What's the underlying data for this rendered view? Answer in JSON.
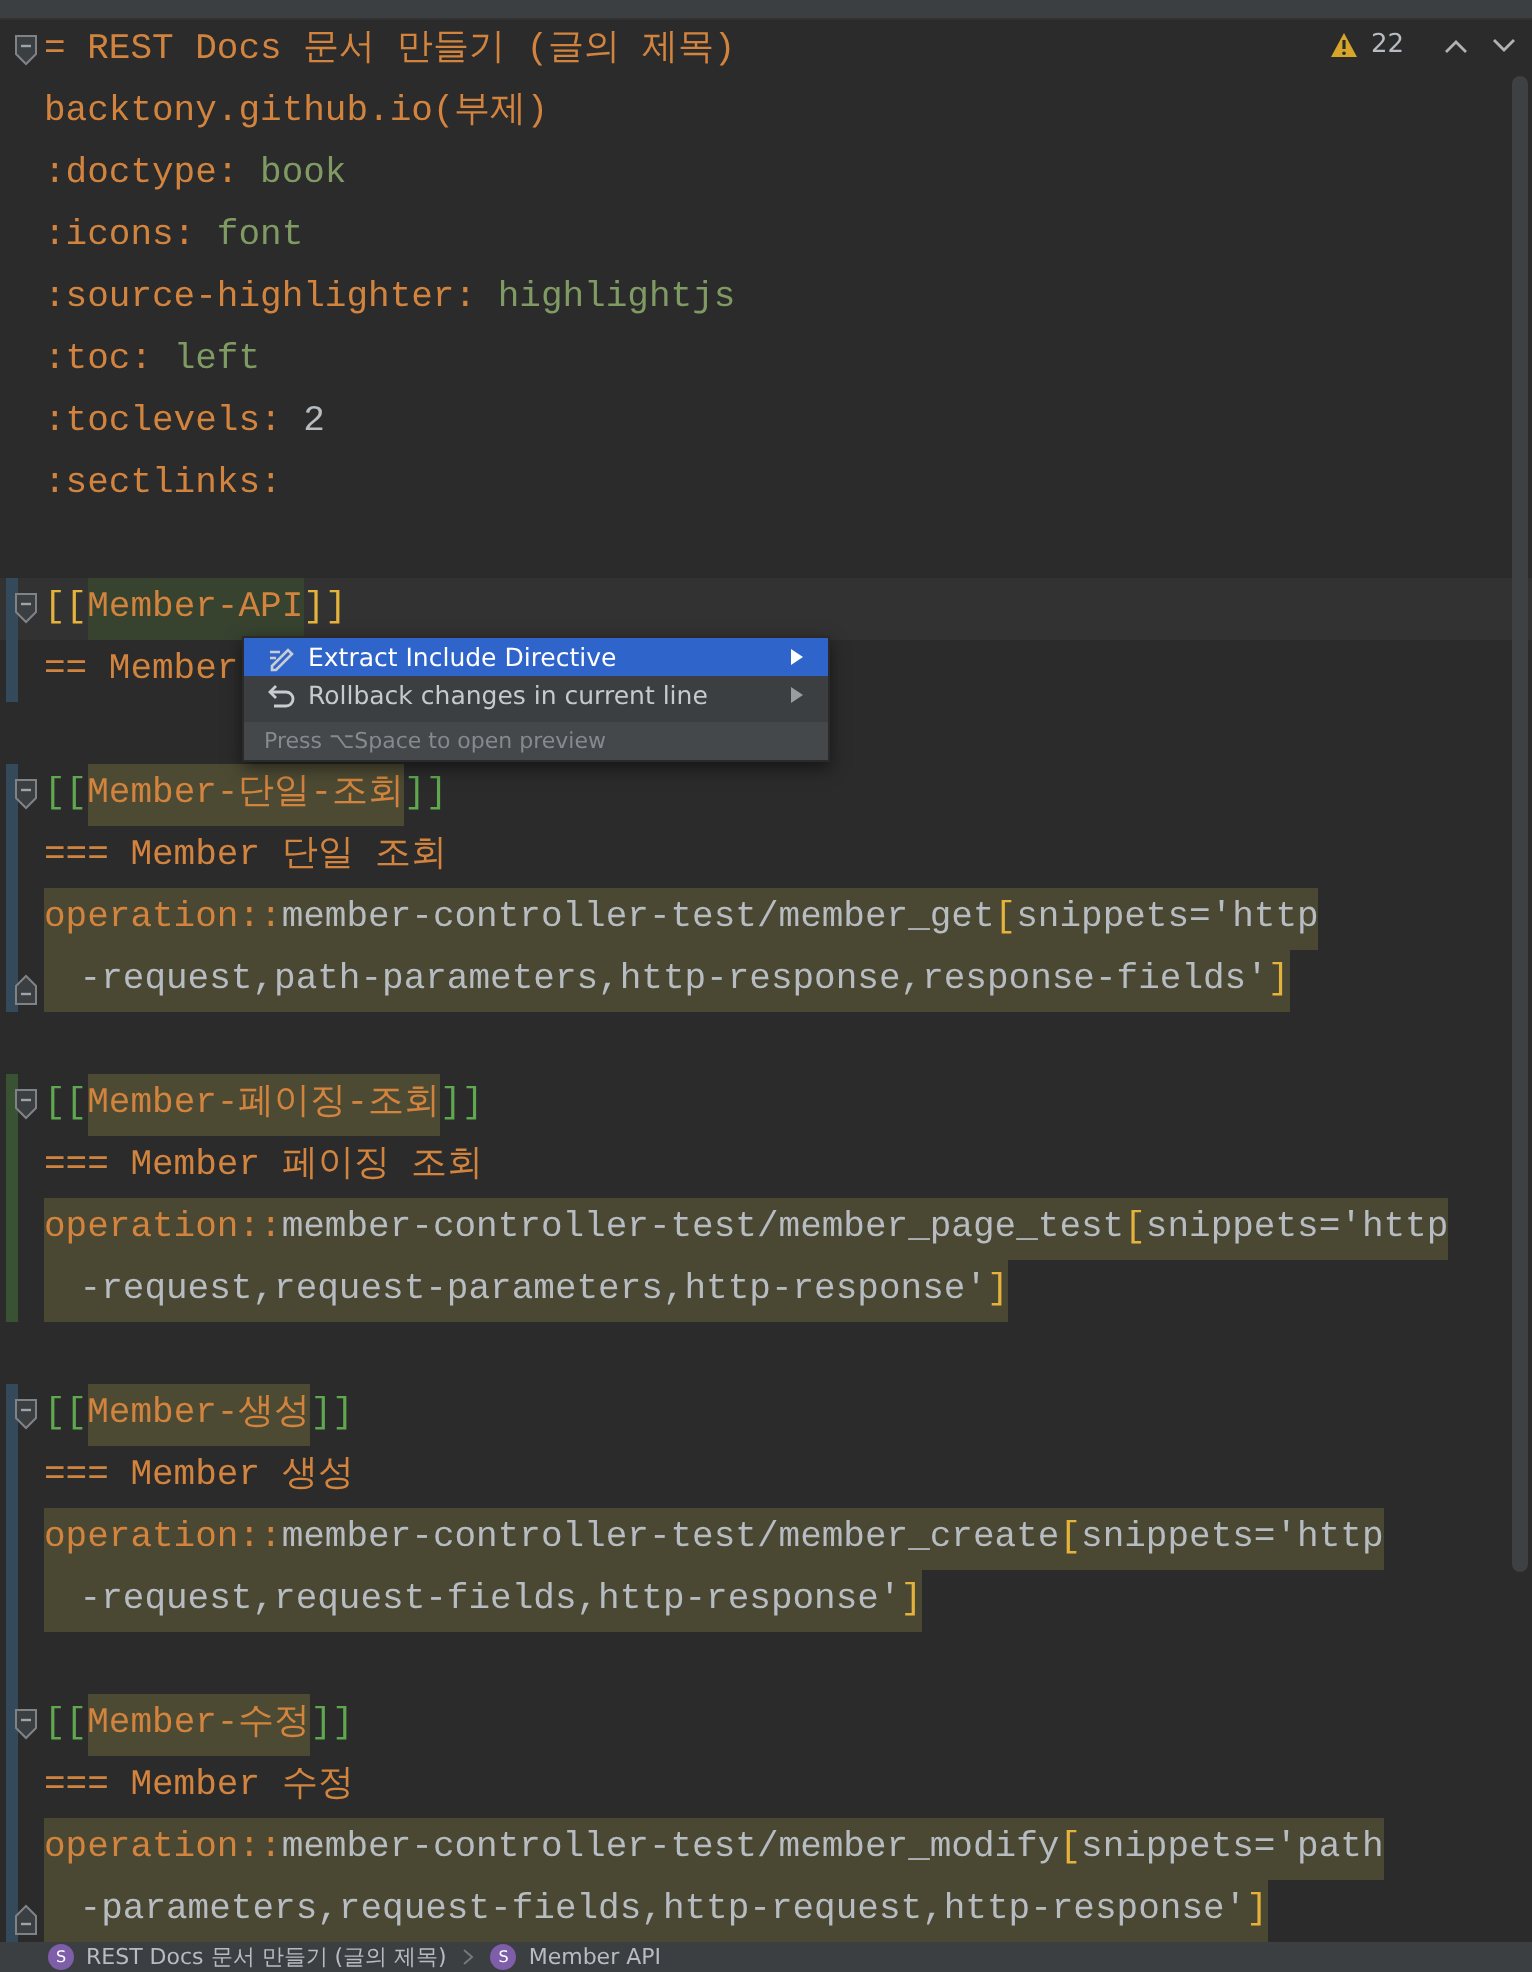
{
  "inspections": {
    "warnings": "22"
  },
  "lines": [
    {
      "kind": "code",
      "fold_start": true,
      "segments": [
        {
          "text": "= REST Docs 문서 만들기 (글의 제목)",
          "kind": "heading"
        }
      ]
    },
    {
      "kind": "code",
      "segments": [
        {
          "text": "backtony.github.io(부제)",
          "kind": "heading"
        }
      ]
    },
    {
      "kind": "code",
      "segments": [
        {
          "text": ":doctype:",
          "kind": "attr"
        },
        {
          "text": " book",
          "kind": "value"
        }
      ]
    },
    {
      "kind": "code",
      "segments": [
        {
          "text": ":icons:",
          "kind": "attr"
        },
        {
          "text": " font",
          "kind": "value"
        }
      ]
    },
    {
      "kind": "code",
      "segments": [
        {
          "text": ":source-highlighter:",
          "kind": "attr"
        },
        {
          "text": " highlightjs",
          "kind": "value"
        }
      ]
    },
    {
      "kind": "code",
      "segments": [
        {
          "text": ":toc:",
          "kind": "attr"
        },
        {
          "text": " left",
          "kind": "value"
        }
      ]
    },
    {
      "kind": "code",
      "segments": [
        {
          "text": ":toclevels:",
          "kind": "attr"
        },
        {
          "text": " 2",
          "kind": "plain"
        }
      ]
    },
    {
      "kind": "code",
      "segments": [
        {
          "text": ":sectlinks:",
          "kind": "attr"
        }
      ]
    },
    {
      "kind": "blank"
    },
    {
      "kind": "code",
      "fold_start": true,
      "current": true,
      "modified": true,
      "segments": [
        {
          "text": "[[",
          "kind": "bracket"
        },
        {
          "text": "Member-API",
          "kind": "anchor-current"
        },
        {
          "text": "]]",
          "kind": "bracket"
        }
      ]
    },
    {
      "kind": "code",
      "modified": true,
      "segments": [
        {
          "text": "== Member",
          "kind": "heading"
        }
      ]
    },
    {
      "kind": "blank"
    },
    {
      "kind": "code",
      "fold_start": true,
      "modified": true,
      "segments": [
        {
          "text": "[[",
          "kind": "bracket-alt"
        },
        {
          "text": "Member-단일-조회",
          "kind": "anchor"
        },
        {
          "text": "]]",
          "kind": "bracket-alt"
        }
      ]
    },
    {
      "kind": "code",
      "modified": true,
      "segments": [
        {
          "text": "=== Member 단일 조회",
          "kind": "heading"
        }
      ]
    },
    {
      "kind": "code",
      "modified": true,
      "highlight": true,
      "segments": [
        {
          "text": "operation::",
          "kind": "macro"
        },
        {
          "text": "member-controller-test/member_get",
          "kind": "plain"
        },
        {
          "text": "[",
          "kind": "bracket"
        },
        {
          "text": "snippets='http",
          "kind": "plain"
        }
      ]
    },
    {
      "kind": "code",
      "fold_end": true,
      "modified": true,
      "highlight": true,
      "wrapped": true,
      "segments": [
        {
          "text": " -request,path-parameters,http-response,response-fields'",
          "kind": "plain"
        },
        {
          "text": "]",
          "kind": "bracket"
        }
      ]
    },
    {
      "kind": "blank"
    },
    {
      "kind": "code",
      "fold_start": true,
      "added": true,
      "segments": [
        {
          "text": "[[",
          "kind": "bracket-alt"
        },
        {
          "text": "Member-페이징-조회",
          "kind": "anchor"
        },
        {
          "text": "]]",
          "kind": "bracket-alt"
        }
      ]
    },
    {
      "kind": "code",
      "added": true,
      "segments": [
        {
          "text": "=== Member 페이징 조회",
          "kind": "heading"
        }
      ]
    },
    {
      "kind": "code",
      "added": true,
      "highlight": true,
      "segments": [
        {
          "text": "operation::",
          "kind": "macro"
        },
        {
          "text": "member-controller-test/member_page_test",
          "kind": "plain"
        },
        {
          "text": "[",
          "kind": "bracket"
        },
        {
          "text": "snippets='http",
          "kind": "plain"
        }
      ]
    },
    {
      "kind": "code",
      "added": true,
      "highlight": true,
      "wrapped": true,
      "segments": [
        {
          "text": " -request,request-parameters,http-response'",
          "kind": "plain"
        },
        {
          "text": "]",
          "kind": "bracket"
        }
      ]
    },
    {
      "kind": "blank"
    },
    {
      "kind": "code",
      "fold_start": true,
      "modified": true,
      "segments": [
        {
          "text": "[[",
          "kind": "bracket-alt"
        },
        {
          "text": "Member-생성",
          "kind": "anchor"
        },
        {
          "text": "]]",
          "kind": "bracket-alt"
        }
      ]
    },
    {
      "kind": "code",
      "modified": true,
      "segments": [
        {
          "text": "=== Member 생성",
          "kind": "heading"
        }
      ]
    },
    {
      "kind": "code",
      "modified": true,
      "highlight": true,
      "segments": [
        {
          "text": "operation::",
          "kind": "macro"
        },
        {
          "text": "member-controller-test/member_create",
          "kind": "plain"
        },
        {
          "text": "[",
          "kind": "bracket"
        },
        {
          "text": "snippets='http",
          "kind": "plain"
        }
      ]
    },
    {
      "kind": "code",
      "modified": true,
      "highlight": true,
      "wrapped": true,
      "segments": [
        {
          "text": " -request,request-fields,http-response'",
          "kind": "plain"
        },
        {
          "text": "]",
          "kind": "bracket"
        }
      ]
    },
    {
      "kind": "blank",
      "modified": true
    },
    {
      "kind": "code",
      "fold_start": true,
      "modified": true,
      "segments": [
        {
          "text": "[[",
          "kind": "bracket-alt"
        },
        {
          "text": "Member-수정",
          "kind": "anchor"
        },
        {
          "text": "]]",
          "kind": "bracket-alt"
        }
      ]
    },
    {
      "kind": "code",
      "modified": true,
      "segments": [
        {
          "text": "=== Member 수정",
          "kind": "heading"
        }
      ]
    },
    {
      "kind": "code",
      "modified": true,
      "highlight": true,
      "segments": [
        {
          "text": "operation::",
          "kind": "macro"
        },
        {
          "text": "member-controller-test/member_modify",
          "kind": "plain"
        },
        {
          "text": "[",
          "kind": "bracket"
        },
        {
          "text": "snippets='path",
          "kind": "plain"
        }
      ]
    },
    {
      "kind": "code",
      "fold_end": true,
      "modified": true,
      "highlight": true,
      "wrapped": true,
      "segments": [
        {
          "text": " -parameters,request-fields,http-request,http-response'",
          "kind": "plain"
        },
        {
          "text": "]",
          "kind": "bracket"
        }
      ]
    }
  ],
  "popup": {
    "items": [
      {
        "label": "Extract Include Directive",
        "submenu": true,
        "selected": true
      },
      {
        "label": "Rollback changes in current line",
        "submenu": true,
        "selected": false
      }
    ],
    "hint": "Press ⌥Space to open preview"
  },
  "breadcrumbs": [
    {
      "badge": "S",
      "label": "REST Docs 문서 만들기 (글의 제목)"
    },
    {
      "badge": "S",
      "label": "Member API"
    }
  ]
}
